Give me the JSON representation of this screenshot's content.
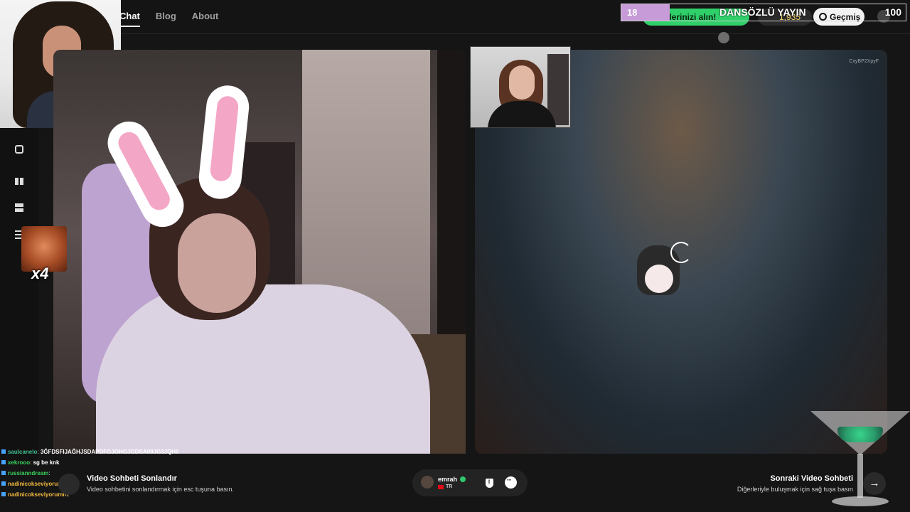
{
  "nav": {
    "chat": "Chat",
    "blog": "Blog",
    "about": "About"
  },
  "header": {
    "promo_text": "llerinizi alın!",
    "coins": "1,935",
    "history_label": "Geçmiş"
  },
  "overlay": {
    "level": "18",
    "title": "DANSÖZLÜ YAYIN",
    "count": "100"
  },
  "emote": {
    "multiplier": "x4"
  },
  "video": {
    "room_id": "CxyBP2XpyF"
  },
  "chat": [
    {
      "user": "saulcanelo",
      "message": "3ĞFDSFIJAĞHJSDAPDFGJOHGJGDSA09JG3JQH0",
      "color": "#3fbf8f"
    },
    {
      "user": "xekrooo",
      "message": "sg be knk",
      "color": "#3ad15b"
    },
    {
      "user": "russianndream",
      "message": "",
      "color": "#3ad15b"
    },
    {
      "user": "nadinicokseviyorum",
      "message": "SC",
      "color": "#f1b840"
    },
    {
      "user": "nadinicokseviyorumm",
      "message": "",
      "color": "#f1b840"
    }
  ],
  "bottom": {
    "end_title": "Video Sohbeti Sonlandır",
    "end_subtitle": "Video sohbetini sonlandırmak için esc tuşuna basın.",
    "partner_name": "emrah",
    "partner_country": "TR",
    "next_title": "Sonraki Video Sohbeti",
    "next_subtitle": "Diğerleriyle buluşmak için sağ tuşa basın",
    "next_arrow": "→"
  },
  "colors": {
    "accent_green": "#2fcf6a",
    "level_purple": "#c79bd8",
    "background": "#151515"
  }
}
